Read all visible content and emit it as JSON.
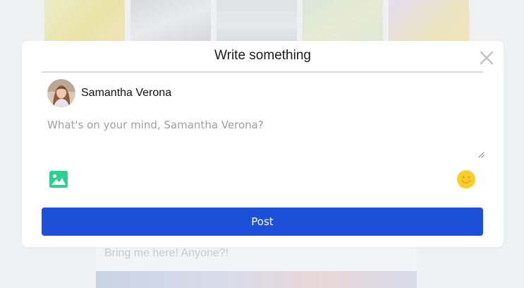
{
  "background": {
    "post_text": "Bring me here! Anyone?!"
  },
  "modal": {
    "title": "Write something",
    "close_icon": "close-icon",
    "author": {
      "name": "Samantha Verona",
      "avatar_icon": "avatar"
    },
    "composer": {
      "placeholder": "What's on your mind, Samantha Verona?",
      "value": ""
    },
    "toolbar": {
      "photo_icon": "image-icon",
      "emoji_icon": "smiley-icon"
    },
    "post_button_label": "Post"
  },
  "colors": {
    "primary_button": "#1c50d8",
    "photo_icon": "#2ecf8f",
    "emoji_icon": "#f7cf2c",
    "page_background": "#eef0f2"
  }
}
